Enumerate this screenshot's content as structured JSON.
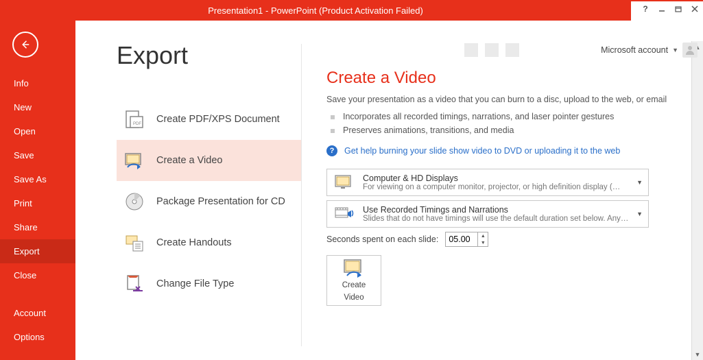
{
  "titlebar": {
    "title": "Presentation1 -  PowerPoint (Product Activation Failed)"
  },
  "account": {
    "label": "Microsoft account"
  },
  "sidebar": {
    "items": [
      {
        "label": "Info"
      },
      {
        "label": "New"
      },
      {
        "label": "Open"
      },
      {
        "label": "Save"
      },
      {
        "label": "Save As"
      },
      {
        "label": "Print"
      },
      {
        "label": "Share"
      },
      {
        "label": "Export"
      },
      {
        "label": "Close"
      }
    ],
    "bottom": [
      {
        "label": "Account"
      },
      {
        "label": "Options"
      }
    ],
    "selected_index": 7
  },
  "page": {
    "title": "Export",
    "options": [
      {
        "label": "Create PDF/XPS Document"
      },
      {
        "label": "Create a Video"
      },
      {
        "label": "Package Presentation for CD"
      },
      {
        "label": "Create Handouts"
      },
      {
        "label": "Change File Type"
      }
    ],
    "selected_option_index": 1
  },
  "video": {
    "heading": "Create a Video",
    "subtitle": "Save your presentation as a video that you can burn to a disc, upload to the web, or email",
    "bullets": [
      "Incorporates all recorded timings, narrations, and laser pointer gestures",
      "Preserves animations, transitions, and media"
    ],
    "help_link": "Get help burning your slide show video to DVD or uploading it to the web",
    "quality": {
      "title": "Computer & HD Displays",
      "desc": "For viewing on a computer monitor, projector, or high definition display  (…"
    },
    "timings": {
      "title": "Use Recorded Timings and Narrations",
      "desc": "Slides that do not have timings will use the default duration set below. Any…"
    },
    "seconds_label": "Seconds spent on each slide:",
    "seconds_value": "05.00",
    "create_button_line1": "Create",
    "create_button_line2": "Video"
  },
  "colors": {
    "accent": "#e7301b",
    "link": "#2a6fc9"
  }
}
